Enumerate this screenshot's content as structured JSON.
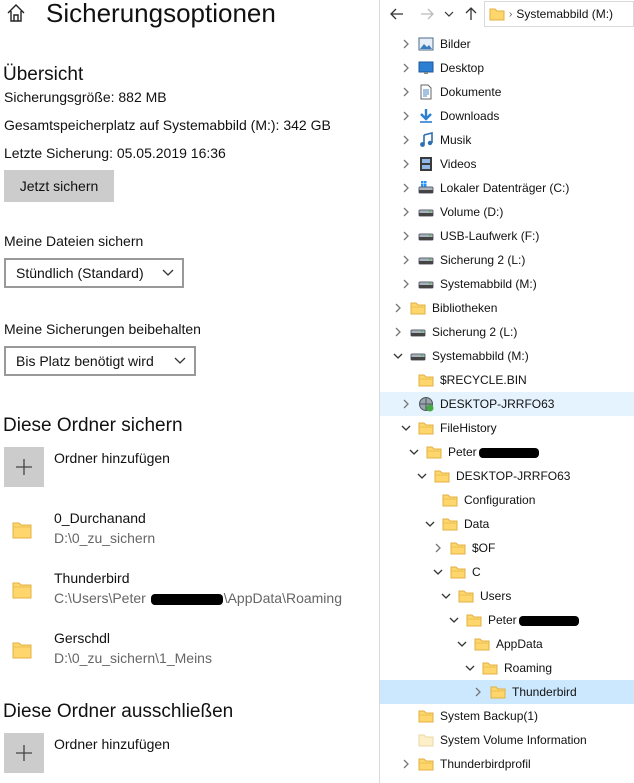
{
  "settings": {
    "title": "Sicherungsoptionen",
    "overview": {
      "heading": "Übersicht",
      "backup_size": "Sicherungsgröße: 882 MB",
      "total_space": "Gesamtspeicherplatz auf Systemabbild (M:): 342 GB",
      "last_backup": "Letzte Sicherung: 05.05.2019 16:36",
      "backup_now_label": "Jetzt sichern"
    },
    "backup_files": {
      "label": "Meine Dateien sichern",
      "selected": "Stündlich (Standard)"
    },
    "keep_backups": {
      "label": "Meine Sicherungen beibehalten",
      "selected": "Bis Platz benötigt wird"
    },
    "include": {
      "heading": "Diese Ordner sichern",
      "add_label": "Ordner hinzufügen",
      "folders": [
        {
          "name": "0_Durchanand",
          "path": "D:\\0_zu_sichern"
        },
        {
          "name": "Thunderbird",
          "path_start": "C:\\Users\\Peter ",
          "path_end": "\\AppData\\Roaming"
        },
        {
          "name": "Gerschdl",
          "path": "D:\\0_zu_sichern\\1_Meins"
        }
      ]
    },
    "exclude": {
      "heading": "Diese Ordner ausschließen",
      "add_label": "Ordner hinzufügen"
    }
  },
  "explorer": {
    "address": "Systemabbild (M:)",
    "tree": [
      {
        "label": "Bilder",
        "icon": "pictures-icon",
        "level": 1,
        "expander": "collapsed"
      },
      {
        "label": "Desktop",
        "icon": "desktop-icon",
        "level": 1,
        "expander": "collapsed"
      },
      {
        "label": "Dokumente",
        "icon": "documents-icon",
        "level": 1,
        "expander": "collapsed"
      },
      {
        "label": "Downloads",
        "icon": "downloads-icon",
        "level": 1,
        "expander": "collapsed"
      },
      {
        "label": "Musik",
        "icon": "music-icon",
        "level": 1,
        "expander": "collapsed"
      },
      {
        "label": "Videos",
        "icon": "videos-icon",
        "level": 1,
        "expander": "collapsed"
      },
      {
        "label": "Lokaler Datenträger (C:)",
        "icon": "system-drive-icon",
        "level": 1,
        "expander": "collapsed"
      },
      {
        "label": "Volume (D:)",
        "icon": "drive-icon",
        "level": 1,
        "expander": "collapsed"
      },
      {
        "label": "USB-Laufwerk (F:)",
        "icon": "drive-icon",
        "level": 1,
        "expander": "collapsed"
      },
      {
        "label": "Sicherung 2 (L:)",
        "icon": "drive-icon",
        "level": 1,
        "expander": "collapsed"
      },
      {
        "label": "Systemabbild (M:)",
        "icon": "drive-icon",
        "level": 1,
        "expander": "collapsed"
      },
      {
        "label": "Bibliotheken",
        "icon": "folder-icon",
        "level": 0,
        "expander": "collapsed"
      },
      {
        "label": "Sicherung 2 (L:)",
        "icon": "drive-icon",
        "level": 0,
        "expander": "collapsed"
      },
      {
        "label": "Systemabbild (M:)",
        "icon": "drive-icon",
        "level": 0,
        "expander": "expanded"
      },
      {
        "label": "$RECYCLE.BIN",
        "icon": "folder-icon",
        "level": 1,
        "expander": "none"
      },
      {
        "label": "DESKTOP-JRRFO63",
        "icon": "network-computer-icon",
        "level": 1,
        "expander": "collapsed",
        "state": "hover"
      },
      {
        "label": "FileHistory",
        "icon": "folder-icon",
        "level": 1,
        "expander": "expanded"
      },
      {
        "label": "Peter",
        "icon": "folder-icon",
        "level": 2,
        "expander": "expanded",
        "redacted": true
      },
      {
        "label": "DESKTOP-JRRFO63",
        "icon": "folder-icon",
        "level": 3,
        "expander": "expanded"
      },
      {
        "label": "Configuration",
        "icon": "folder-icon",
        "level": 4,
        "expander": "none"
      },
      {
        "label": "Data",
        "icon": "folder-icon",
        "level": 4,
        "expander": "expanded"
      },
      {
        "label": "$OF",
        "icon": "folder-icon",
        "level": 5,
        "expander": "collapsed"
      },
      {
        "label": "C",
        "icon": "folder-icon",
        "level": 5,
        "expander": "expanded"
      },
      {
        "label": "Users",
        "icon": "folder-icon",
        "level": 6,
        "expander": "expanded"
      },
      {
        "label": "Peter",
        "icon": "folder-icon",
        "level": 7,
        "expander": "expanded",
        "redacted": true
      },
      {
        "label": "AppData",
        "icon": "folder-icon",
        "level": 8,
        "expander": "expanded"
      },
      {
        "label": "Roaming",
        "icon": "folder-icon",
        "level": 9,
        "expander": "expanded"
      },
      {
        "label": "Thunderbird",
        "icon": "folder-icon",
        "level": 10,
        "expander": "collapsed",
        "state": "selected"
      },
      {
        "label": "System Backup(1)",
        "icon": "folder-icon",
        "level": 1,
        "expander": "none"
      },
      {
        "label": "System Volume Information",
        "icon": "folder-light-icon",
        "level": 1,
        "expander": "none"
      },
      {
        "label": "Thunderbirdprofil",
        "icon": "folder-icon",
        "level": 1,
        "expander": "collapsed"
      }
    ]
  },
  "colors": {
    "folder": "#ffd66b",
    "selected": "#cce8ff",
    "hover": "#e5f3ff",
    "button": "#cccccc"
  }
}
